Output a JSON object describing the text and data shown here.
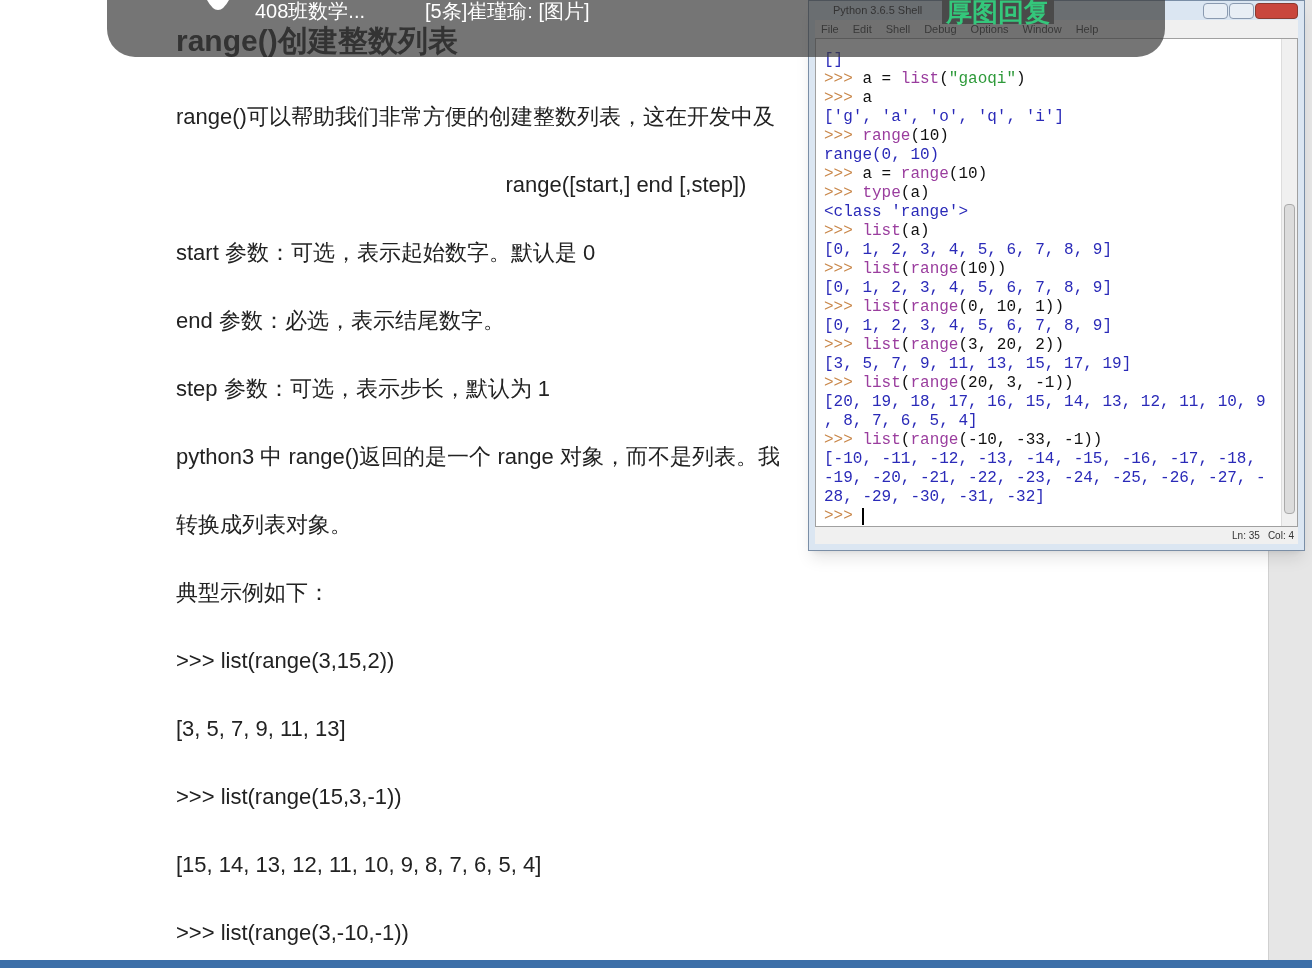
{
  "document": {
    "title": "range()创建整数列表",
    "paragraphs": [
      {
        "text": "range()可以帮助我们非常方便的创建整数列表，这在开发中及",
        "kind": "text"
      },
      {
        "text": "range([start,] end [,step])",
        "kind": "syntax"
      },
      {
        "text": "start 参数：可选，表示起始数字。默认是 0",
        "kind": "text"
      },
      {
        "text": "end 参数：必选，表示结尾数字。",
        "kind": "text"
      },
      {
        "text": "step 参数：可选，表示步长，默认为 1",
        "kind": "text"
      },
      {
        "text": "python3 中 range()返回的是一个 range 对象，而不是列表。我",
        "kind": "text"
      },
      {
        "text": "转换成列表对象。",
        "kind": "text"
      },
      {
        "text": "典型示例如下：",
        "kind": "text"
      },
      {
        "text": ">>> list(range(3,15,2))",
        "kind": "text"
      },
      {
        "text": "[3, 5, 7, 9, 11, 13]",
        "kind": "text"
      },
      {
        "text": ">>> list(range(15,3,-1))",
        "kind": "text"
      },
      {
        "text": "[15, 14, 13, 12, 11, 10, 9, 8, 7, 6, 5, 4]",
        "kind": "text"
      },
      {
        "text": ">>> list(range(3,-10,-1))",
        "kind": "text"
      }
    ]
  },
  "notification": {
    "group": "408班数学...",
    "message": "[5条]崔瑾瑜: [图片]",
    "action": "厚图回复"
  },
  "shell": {
    "title": "Python 3.6.5 Shell",
    "menu": [
      "File",
      "Edit",
      "Shell",
      "Debug",
      "Options",
      "Window",
      "Help"
    ],
    "lines": [
      [
        {
          "text": "[]",
          "kind": "output"
        }
      ],
      [
        {
          "text": ">>> ",
          "kind": "prompt"
        },
        {
          "text": "a = ",
          "kind": "plain"
        },
        {
          "text": "list",
          "kind": "builtin"
        },
        {
          "text": "(",
          "kind": "plain"
        },
        {
          "text": "\"gaoqi\"",
          "kind": "string"
        },
        {
          "text": ")",
          "kind": "plain"
        }
      ],
      [
        {
          "text": ">>> ",
          "kind": "prompt"
        },
        {
          "text": "a",
          "kind": "plain"
        }
      ],
      [
        {
          "text": "['g', 'a', 'o', 'q', 'i']",
          "kind": "output"
        }
      ],
      [
        {
          "text": ">>> ",
          "kind": "prompt"
        },
        {
          "text": "range",
          "kind": "builtin"
        },
        {
          "text": "(10)",
          "kind": "plain"
        }
      ],
      [
        {
          "text": "range(0, 10)",
          "kind": "output"
        }
      ],
      [
        {
          "text": ">>> ",
          "kind": "prompt"
        },
        {
          "text": "a = ",
          "kind": "plain"
        },
        {
          "text": "range",
          "kind": "builtin"
        },
        {
          "text": "(10)",
          "kind": "plain"
        }
      ],
      [
        {
          "text": ">>> ",
          "kind": "prompt"
        },
        {
          "text": "type",
          "kind": "builtin"
        },
        {
          "text": "(a)",
          "kind": "plain"
        }
      ],
      [
        {
          "text": "<class 'range'>",
          "kind": "output"
        }
      ],
      [
        {
          "text": ">>> ",
          "kind": "prompt"
        },
        {
          "text": "list",
          "kind": "builtin"
        },
        {
          "text": "(a)",
          "kind": "plain"
        }
      ],
      [
        {
          "text": "[0, 1, 2, 3, 4, 5, 6, 7, 8, 9]",
          "kind": "output"
        }
      ],
      [
        {
          "text": ">>> ",
          "kind": "prompt"
        },
        {
          "text": "list",
          "kind": "builtin"
        },
        {
          "text": "(",
          "kind": "plain"
        },
        {
          "text": "range",
          "kind": "builtin"
        },
        {
          "text": "(10))",
          "kind": "plain"
        }
      ],
      [
        {
          "text": "[0, 1, 2, 3, 4, 5, 6, 7, 8, 9]",
          "kind": "output"
        }
      ],
      [
        {
          "text": ">>> ",
          "kind": "prompt"
        },
        {
          "text": "list",
          "kind": "builtin"
        },
        {
          "text": "(",
          "kind": "plain"
        },
        {
          "text": "range",
          "kind": "builtin"
        },
        {
          "text": "(0, 10, 1))",
          "kind": "plain"
        }
      ],
      [
        {
          "text": "[0, 1, 2, 3, 4, 5, 6, 7, 8, 9]",
          "kind": "output"
        }
      ],
      [
        {
          "text": ">>> ",
          "kind": "prompt"
        },
        {
          "text": "list",
          "kind": "builtin"
        },
        {
          "text": "(",
          "kind": "plain"
        },
        {
          "text": "range",
          "kind": "builtin"
        },
        {
          "text": "(3, 20, 2))",
          "kind": "plain"
        }
      ],
      [
        {
          "text": "[3, 5, 7, 9, 11, 13, 15, 17, 19]",
          "kind": "output"
        }
      ],
      [
        {
          "text": ">>> ",
          "kind": "prompt"
        },
        {
          "text": "list",
          "kind": "builtin"
        },
        {
          "text": "(",
          "kind": "plain"
        },
        {
          "text": "range",
          "kind": "builtin"
        },
        {
          "text": "(20, 3, -1))",
          "kind": "plain"
        }
      ],
      [
        {
          "text": "[20, 19, 18, 17, 16, 15, 14, 13, 12, 11, 10, 9",
          "kind": "output"
        }
      ],
      [
        {
          "text": ", 8, 7, 6, 5, 4]",
          "kind": "output"
        }
      ],
      [
        {
          "text": ">>> ",
          "kind": "prompt"
        },
        {
          "text": "list",
          "kind": "builtin"
        },
        {
          "text": "(",
          "kind": "plain"
        },
        {
          "text": "range",
          "kind": "builtin"
        },
        {
          "text": "(-10, -33, -1))",
          "kind": "plain"
        }
      ],
      [
        {
          "text": "[-10, -11, -12, -13, -14, -15, -16, -17, -18,",
          "kind": "output"
        }
      ],
      [
        {
          "text": "-19, -20, -21, -22, -23, -24, -25, -26, -27, -",
          "kind": "output"
        }
      ],
      [
        {
          "text": "28, -29, -30, -31, -32]",
          "kind": "output"
        }
      ],
      [
        {
          "text": ">>> ",
          "kind": "prompt"
        }
      ]
    ],
    "status": {
      "line": "Ln: 35",
      "col": "Col: 4"
    }
  }
}
